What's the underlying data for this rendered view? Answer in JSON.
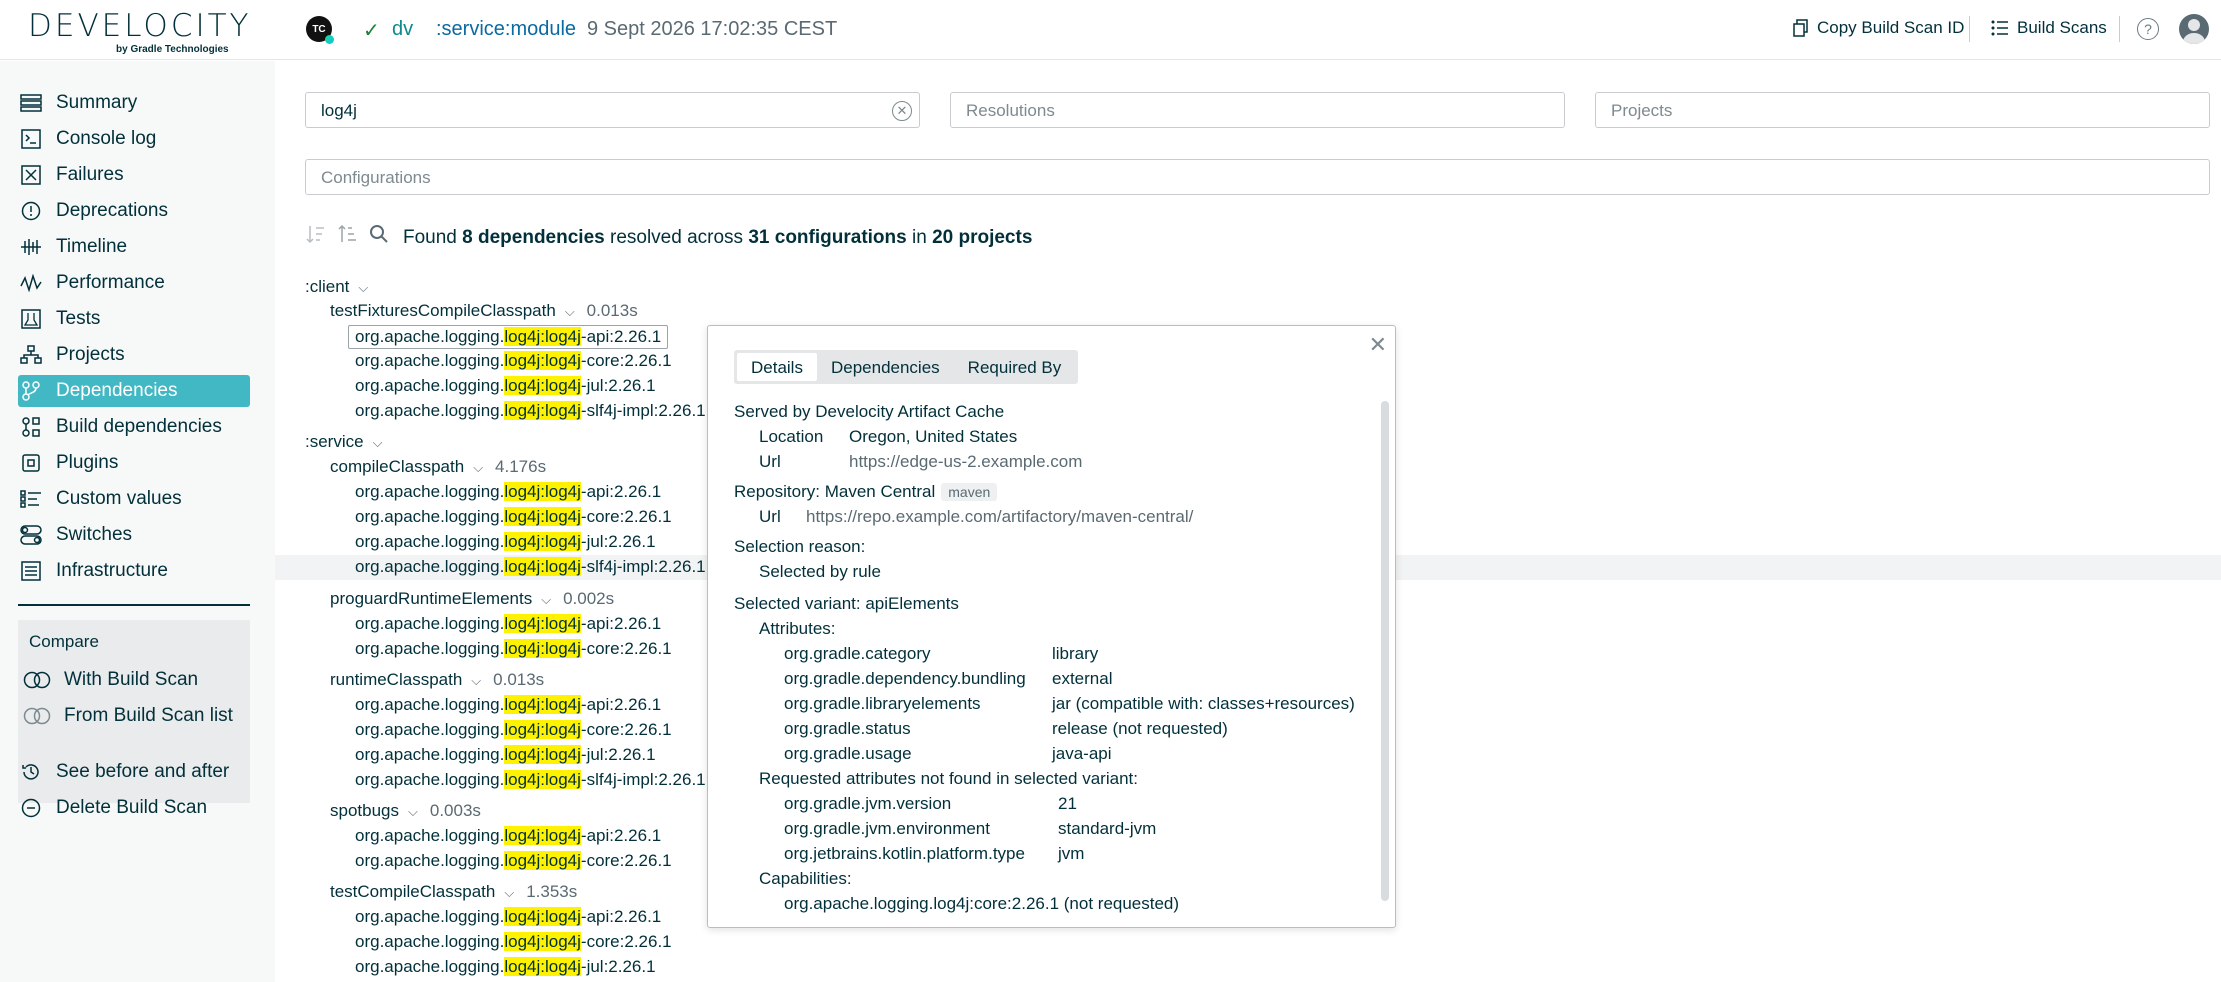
{
  "header": {
    "logo_text": "DEVELOCITY",
    "logo_sub": "by Gradle Technologies",
    "ci_icon_text": "TC",
    "user": "dv",
    "task": ":service:module",
    "timestamp": "9 Sept 2026 17:02:35 CEST",
    "copy_id_label": "Copy Build Scan ID",
    "build_scans_label": "Build Scans",
    "help_glyph": "?"
  },
  "sidebar": {
    "items": [
      {
        "label": "Summary",
        "icon": "summary-icon"
      },
      {
        "label": "Console log",
        "icon": "console-icon"
      },
      {
        "label": "Failures",
        "icon": "failures-icon"
      },
      {
        "label": "Deprecations",
        "icon": "deprecations-icon"
      },
      {
        "label": "Timeline",
        "icon": "timeline-icon"
      },
      {
        "label": "Performance",
        "icon": "performance-icon"
      },
      {
        "label": "Tests",
        "icon": "tests-icon"
      },
      {
        "label": "Projects",
        "icon": "projects-icon"
      },
      {
        "label": "Dependencies",
        "icon": "dependencies-icon"
      },
      {
        "label": "Build dependencies",
        "icon": "build-deps-icon"
      },
      {
        "label": "Plugins",
        "icon": "plugins-icon"
      },
      {
        "label": "Custom values",
        "icon": "custom-values-icon"
      },
      {
        "label": "Switches",
        "icon": "switches-icon"
      },
      {
        "label": "Infrastructure",
        "icon": "infrastructure-icon"
      }
    ],
    "compare": {
      "title": "Compare",
      "with_build_scan": "With Build Scan",
      "from_list": "From Build Scan list"
    },
    "see_before_after": "See before and after",
    "delete_scan": "Delete Build Scan"
  },
  "filters": {
    "search_value": "log4j",
    "resolutions_placeholder": "Resolutions",
    "projects_placeholder": "Projects",
    "configurations_placeholder": "Configurations"
  },
  "summary": {
    "found": "Found",
    "dep_count": "8 dependencies",
    "resolved_across": "resolved across",
    "conf_count": "31 configurations",
    "in": "in",
    "proj_count": "20 projects"
  },
  "tree": {
    "client": ":client",
    "service": ":service",
    "conf_testFixtures": "testFixturesCompileClasspath",
    "dur_testFixtures": "0.013s",
    "conf_compile": "compileClasspath",
    "dur_compile": "4.176s",
    "conf_proguard": "proguardRuntimeElements",
    "dur_proguard": "0.002s",
    "conf_runtime": "runtimeClasspath",
    "dur_runtime": "0.013s",
    "conf_spotbugs": "spotbugs",
    "dur_spotbugs": "0.003s",
    "conf_testCompile": "testCompileClasspath",
    "dur_testCompile": "1.353s",
    "dep_prefix": "org.apache.logging.",
    "dep_match": "log4j:log4j",
    "suffix_api": "-api:2.26.1",
    "suffix_core": "-core:2.26.1",
    "suffix_jul": "-jul:2.26.1",
    "suffix_slf4j": "-slf4j-impl:2.26.1"
  },
  "popup": {
    "tabs": [
      "Details",
      "Dependencies",
      "Required By"
    ],
    "served_by": "Served by Develocity Artifact Cache",
    "location_label": "Location",
    "location_value": "Oregon, United States",
    "url_label": "Url",
    "cache_url": "https://edge-us-2.example.com",
    "repository": "Repository: Maven Central",
    "repo_badge": "maven",
    "repo_url": "https://repo.example.com/artifactory/maven-central/",
    "selection_reason": "Selection reason:",
    "selected_by_rule": "Selected by rule",
    "selected_variant": "Selected variant: apiElements",
    "attributes_label": "Attributes:",
    "attributes": [
      {
        "k": "org.gradle.category",
        "v": "library"
      },
      {
        "k": "org.gradle.dependency.bundling",
        "v": "external"
      },
      {
        "k": "org.gradle.libraryelements",
        "v": "jar (compatible with: classes+resources)"
      },
      {
        "k": "org.gradle.status",
        "v": "release (not requested)"
      },
      {
        "k": "org.gradle.usage",
        "v": "java-api"
      }
    ],
    "requested_not_found": "Requested attributes not found in selected variant:",
    "requested": [
      {
        "k": "org.gradle.jvm.version",
        "v": "21"
      },
      {
        "k": "org.gradle.jvm.environment",
        "v": "standard-jvm"
      },
      {
        "k": "org.jetbrains.kotlin.platform.type",
        "v": "jvm"
      }
    ],
    "capabilities_label": "Capabilities:",
    "capability": "org.apache.logging.log4j:core:2.26.1 (not requested)"
  }
}
